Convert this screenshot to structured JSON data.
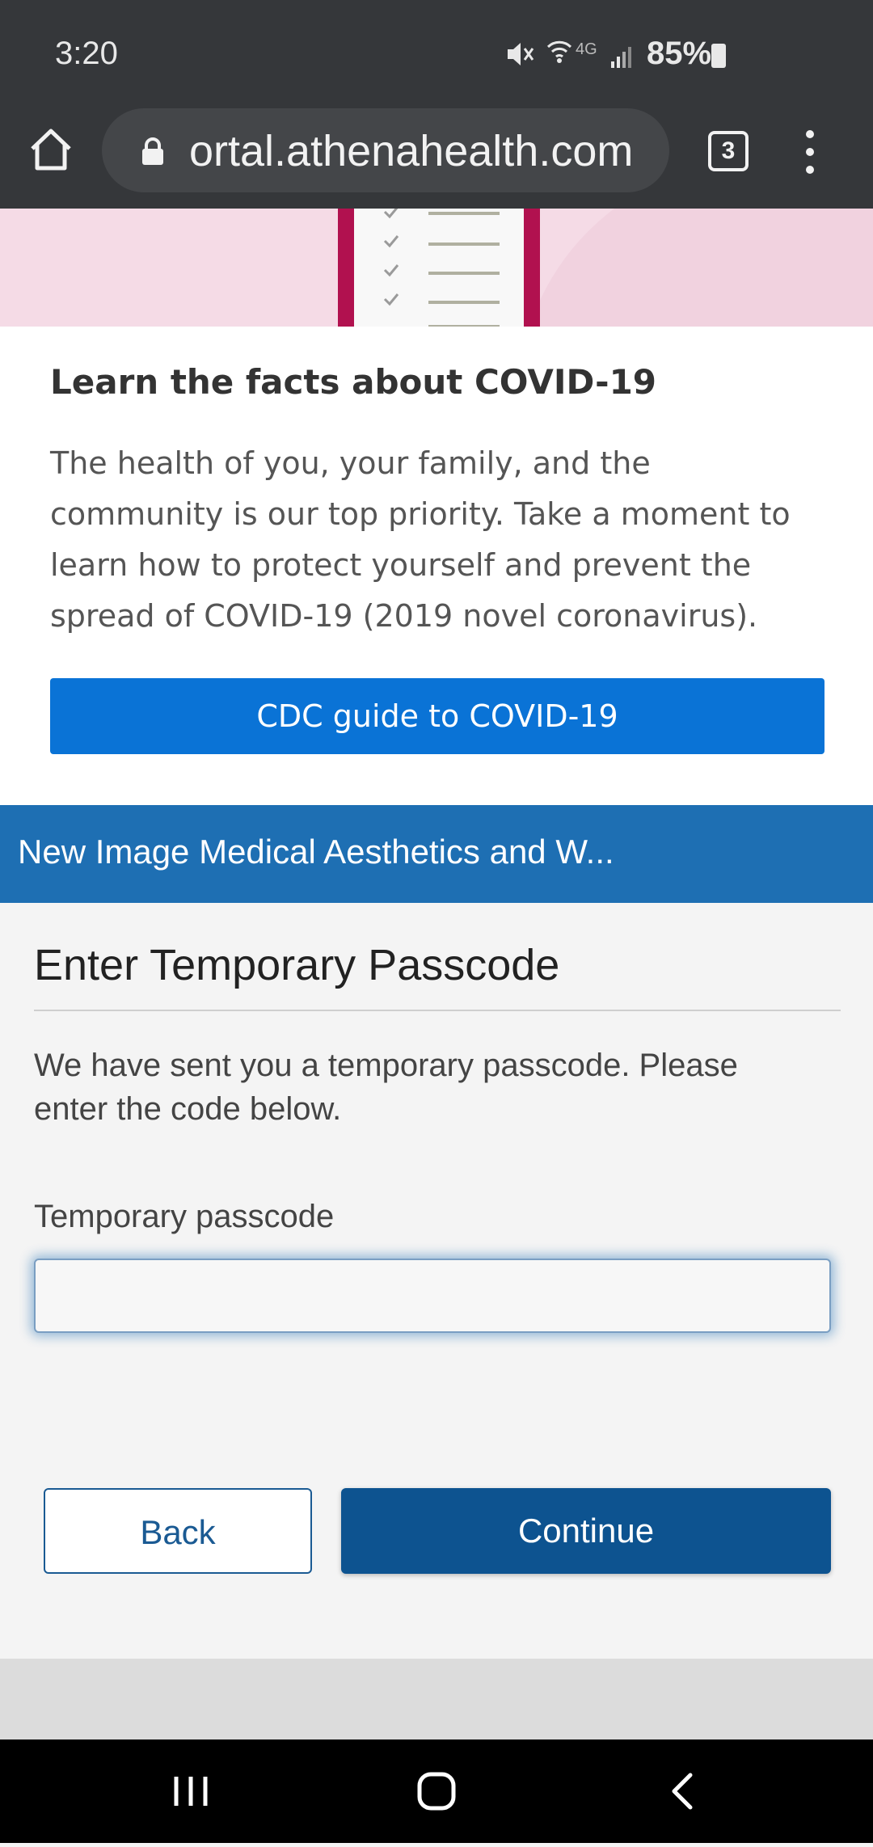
{
  "status_bar": {
    "time": "3:20",
    "network": "4G",
    "battery": "85%"
  },
  "browser": {
    "url": "ortal.athenahealth.com",
    "tab_count": "3"
  },
  "covid_card": {
    "title": "Learn the facts about COVID-19",
    "body": "The health of you, your family, and the community is our top priority. Take a moment to learn how to protect yourself and prevent the spread of COVID-19 (2019 novel coronavirus).",
    "button_label": "CDC guide to COVID-19"
  },
  "practice": {
    "name": "New Image Medical Aesthetics and W..."
  },
  "form": {
    "title": "Enter Temporary Passcode",
    "description": "We have sent you a temporary passcode. Please enter the code below.",
    "passcode_label": "Temporary passcode",
    "passcode_value": "",
    "back_label": "Back",
    "continue_label": "Continue"
  },
  "colors": {
    "status_bar": "#35373a",
    "practice_header": "#1e6fb3",
    "cdc_button": "#0a73d6",
    "continue_button": "#0d5390"
  }
}
